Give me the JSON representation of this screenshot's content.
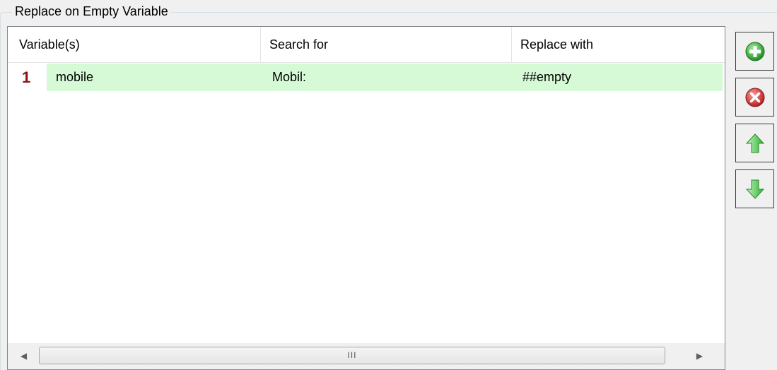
{
  "group": {
    "title": "Replace on Empty Variable"
  },
  "grid": {
    "columns": [
      "Variable(s)",
      "Search for",
      "Replace with"
    ],
    "rows": [
      {
        "number": "1",
        "variables": "mobile",
        "search_for": "Mobil:",
        "replace_with": "##empty"
      }
    ],
    "row_highlight_color": "#d6fad6",
    "row_number_color": "#8b1111",
    "scrollbar": {
      "left_arrow": "◀",
      "right_arrow": "▶",
      "grip": "III"
    }
  },
  "buttons": [
    {
      "name": "add",
      "icon": "green-plus-circle-icon",
      "color": "#2fa82f"
    },
    {
      "name": "remove",
      "icon": "red-x-circle-icon",
      "color": "#cc3030"
    },
    {
      "name": "move-up",
      "icon": "green-up-arrow-icon",
      "color": "#3cc43c"
    },
    {
      "name": "move-down",
      "icon": "green-down-arrow-icon",
      "color": "#3cc43c"
    }
  ]
}
